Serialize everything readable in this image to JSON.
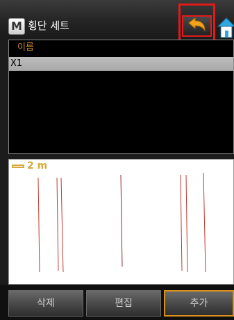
{
  "titlebar": {
    "logo_letter": "M",
    "title": "횡단 세트",
    "back_icon": "back-arrow-icon",
    "home_icon": "home-icon"
  },
  "list": {
    "header": "이름",
    "rows": [
      "X1"
    ]
  },
  "preview": {
    "scale_label": "2 m",
    "line_color": "#c0392b"
  },
  "buttons": {
    "delete": "삭제",
    "edit": "편집",
    "add": "추가"
  },
  "colors": {
    "accent": "#d9901f",
    "highlight": "#e11b1b",
    "header_text": "#c8882e"
  }
}
